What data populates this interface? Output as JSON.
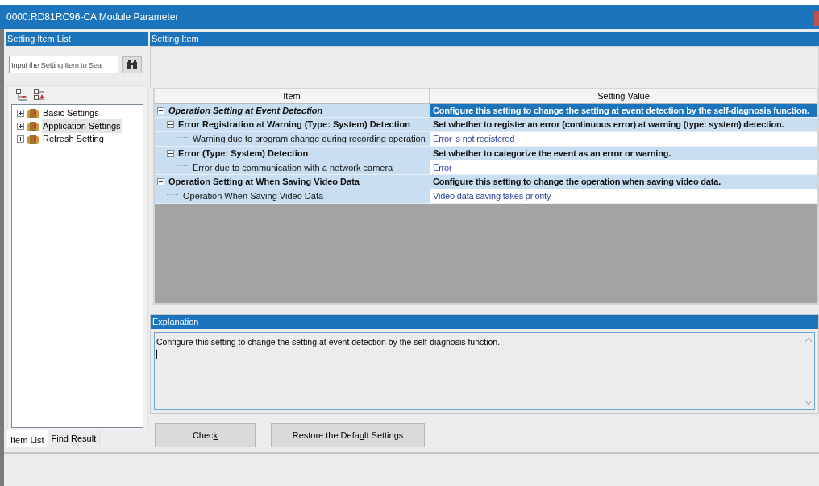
{
  "window": {
    "title": "0000:RD81RC96-CA Module Parameter"
  },
  "left_panel": {
    "title": "Setting Item List",
    "search": {
      "placeholder": "Input the Setting Item to Sea"
    },
    "tree": [
      {
        "label": "Basic Settings",
        "expanded": false,
        "selected": false
      },
      {
        "label": "Application Settings",
        "expanded": false,
        "selected": true
      },
      {
        "label": "Refresh Setting",
        "expanded": false,
        "selected": false
      }
    ],
    "tabs": [
      {
        "label": "Item List",
        "selected": true
      },
      {
        "label": "Find Result",
        "selected": false
      }
    ]
  },
  "setting_item": {
    "title": "Setting Item",
    "columns": [
      "Item",
      "Setting Value"
    ],
    "rows": [
      {
        "item": "Operation Setting at Event Detection",
        "value": "Configure this setting to change the setting at event detection by the self-diagnosis function.",
        "selected": true,
        "expanded": true,
        "children": [
          {
            "item": "Error Registration at Warning (Type: System) Detection",
            "value": "Set whether to register an error (continuous error) at warning (type: system) detection.",
            "selected": false,
            "expanded": true,
            "children": [
              {
                "item": "Warning due to program change during recording operation",
                "value": "Error is not registered",
                "selected": false
              }
            ]
          },
          {
            "item": "Error (Type: System) Detection",
            "value": "Set whether to categorize the event as an error or warning.",
            "selected": false,
            "expanded": true,
            "children": [
              {
                "item": "Error due to communication with a network camera",
                "value": "Error",
                "selected": false
              }
            ]
          }
        ]
      },
      {
        "item": "Operation Setting at When Saving Video Data",
        "value": "Configure this setting to change the operation when saving video data.",
        "selected": false,
        "expanded": true,
        "children": [
          {
            "item": "Operation When Saving Video Data",
            "value": "Video data saving takes priority",
            "selected": false
          }
        ]
      }
    ]
  },
  "explanation": {
    "title": "Explanation",
    "text": "Configure this setting to change the setting at event detection by the self-diagnosis function."
  },
  "buttons": [
    {
      "label_parts": [
        "Chec",
        "k"
      ]
    },
    {
      "label_parts": [
        "Restore the Defa",
        "u",
        "lt Settings"
      ]
    }
  ]
}
